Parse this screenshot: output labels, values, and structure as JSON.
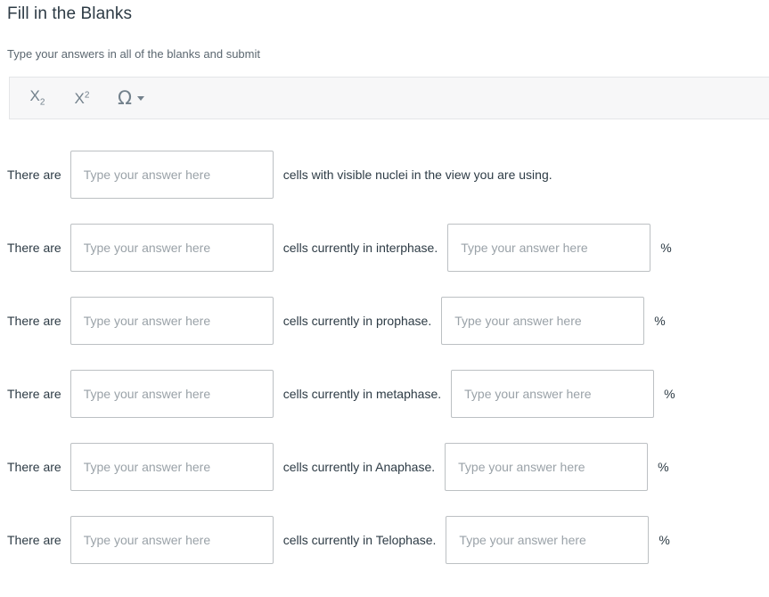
{
  "header": {
    "title": "Fill in the Blanks",
    "subtitle": "Type your answers in all of the blanks and submit"
  },
  "toolbar": {
    "subscript_label": "X",
    "subscript_index": "2",
    "superscript_label": "X",
    "superscript_index": "2",
    "omega_label": "Ω",
    "items": [
      {
        "name": "subscript-button",
        "label": "X₂"
      },
      {
        "name": "superscript-button",
        "label": "X²"
      },
      {
        "name": "special-characters-button",
        "label": "Ω"
      }
    ]
  },
  "form": {
    "placeholder": "Type your answer here",
    "percent_symbol": "%",
    "rows": [
      {
        "lead": "There are",
        "middle": "cells with visible nuclei in the view you are using.",
        "value": "",
        "has_percent": false,
        "percent_value": ""
      },
      {
        "lead": "There are",
        "middle": "cells currently in interphase.",
        "value": "",
        "has_percent": true,
        "percent_value": ""
      },
      {
        "lead": "There are",
        "middle": "cells currently in prophase.",
        "value": "",
        "has_percent": true,
        "percent_value": ""
      },
      {
        "lead": "There are",
        "middle": "cells currently in metaphase.",
        "value": "",
        "has_percent": true,
        "percent_value": ""
      },
      {
        "lead": "There are",
        "middle": "cells currently in Anaphase.",
        "value": "",
        "has_percent": true,
        "percent_value": ""
      },
      {
        "lead": "There are",
        "middle": "cells currently in Telophase.",
        "value": "",
        "has_percent": true,
        "percent_value": ""
      }
    ]
  },
  "colors": {
    "text": "#2d3b45",
    "muted": "#5b6770",
    "placeholder": "#9aa2a8",
    "border": "#bcc0c3",
    "toolbar_bg": "#f7f7f8",
    "toolbar_border": "#e4e6e8",
    "icon": "#73818c"
  }
}
